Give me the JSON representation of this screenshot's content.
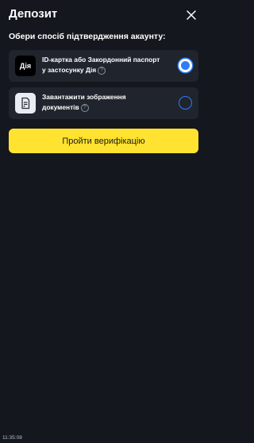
{
  "header": {
    "title": "Депозит"
  },
  "subtitle": "Обери спосіб підтвердження акаунту:",
  "options": [
    {
      "icon_text": "Дія",
      "icon": "diia-logo",
      "label_line1": "ID-картка або Закордонний паспорт",
      "label_line2": "у застосунку Дія",
      "selected": true
    },
    {
      "icon": "document-icon",
      "label_line1": "Завантажити зображення",
      "label_line2": "документів",
      "selected": false
    }
  ],
  "help_glyph": "?",
  "cta_label": "Пройти верифікацію",
  "status_time": "11:35:08",
  "colors": {
    "background": "#14171d",
    "card": "#20242d",
    "accent": "#2f7cf6",
    "cta": "#ffe330"
  }
}
